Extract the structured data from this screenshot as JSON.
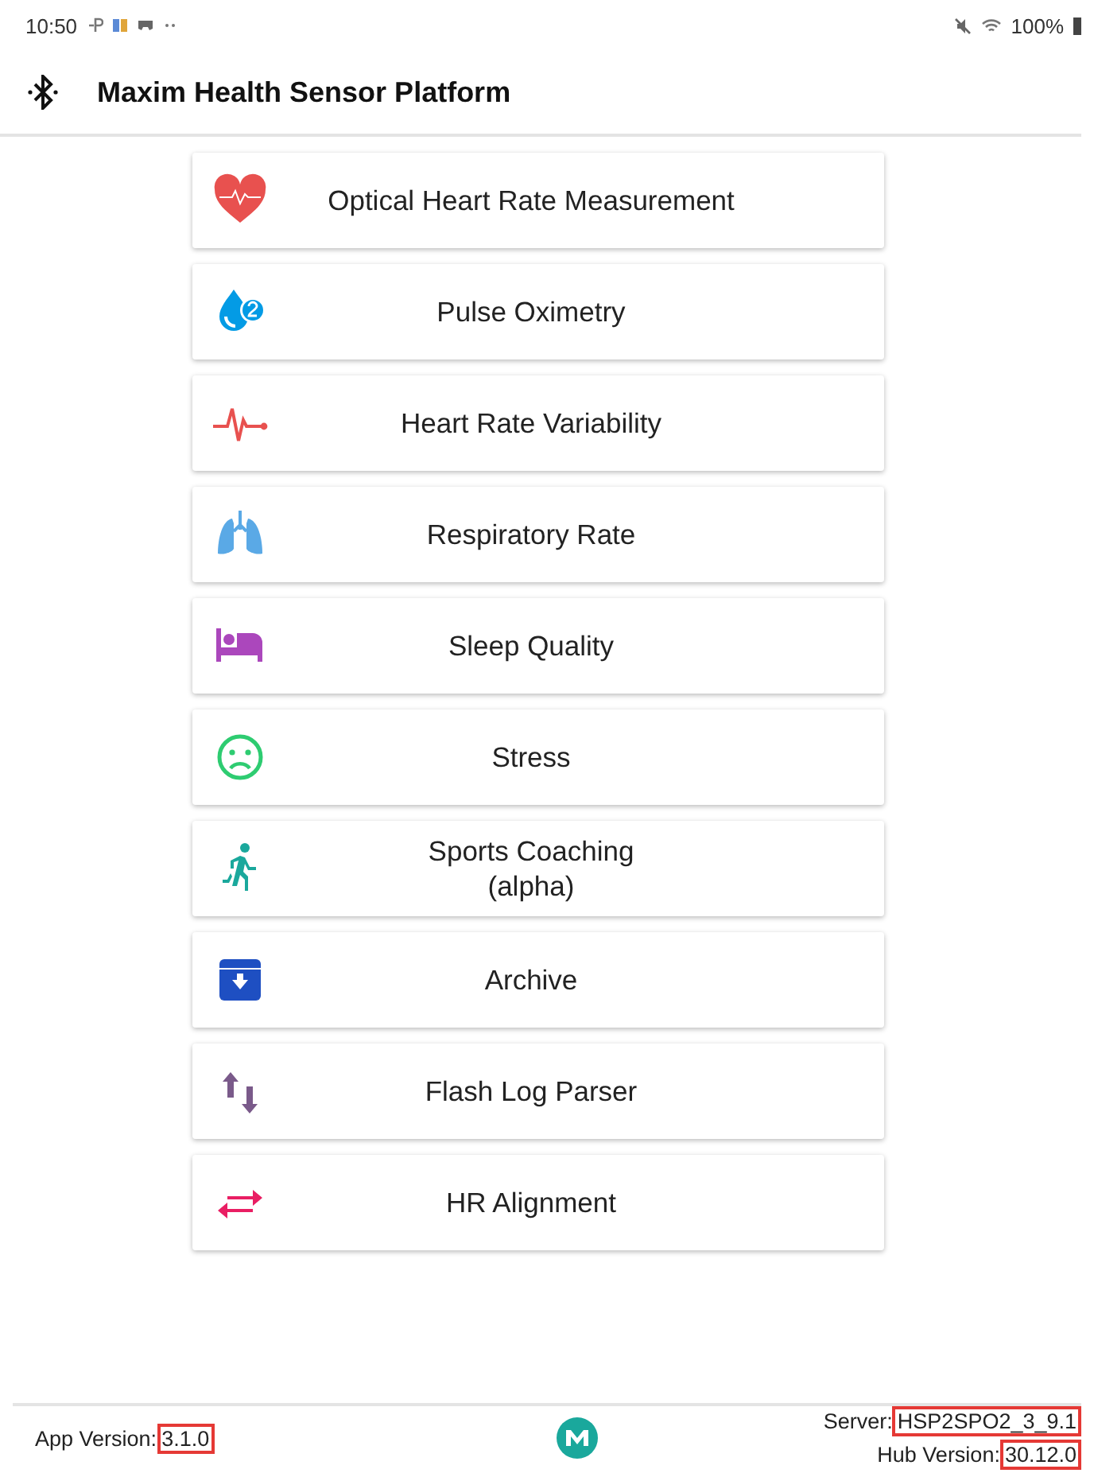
{
  "status_bar": {
    "time": "10:50",
    "battery": "100%"
  },
  "app_bar": {
    "title": "Maxim Health Sensor Platform"
  },
  "menu": [
    {
      "kind": "heart",
      "label": "Optical Heart Rate Measurement"
    },
    {
      "kind": "drop",
      "label": "Pulse Oximetry"
    },
    {
      "kind": "pulse",
      "label": "Heart Rate Variability"
    },
    {
      "kind": "lungs",
      "label": "Respiratory Rate"
    },
    {
      "kind": "bed",
      "label": "Sleep Quality"
    },
    {
      "kind": "face",
      "label": "Stress"
    },
    {
      "kind": "runner",
      "label": "Sports Coaching\n(alpha)"
    },
    {
      "kind": "archive",
      "label": "Archive"
    },
    {
      "kind": "updown",
      "label": "Flash Log Parser"
    },
    {
      "kind": "swap",
      "label": "HR Alignment"
    }
  ],
  "footer": {
    "app_version": {
      "label": "App Version:",
      "value": "3.1.0",
      "highlighted": true
    },
    "server": {
      "label": "Server:",
      "value": "HSP2SPO2_3_9.1",
      "highlighted": true
    },
    "hub_version": {
      "label": "Hub Version:",
      "value": "30.12.0",
      "highlighted": true
    }
  }
}
